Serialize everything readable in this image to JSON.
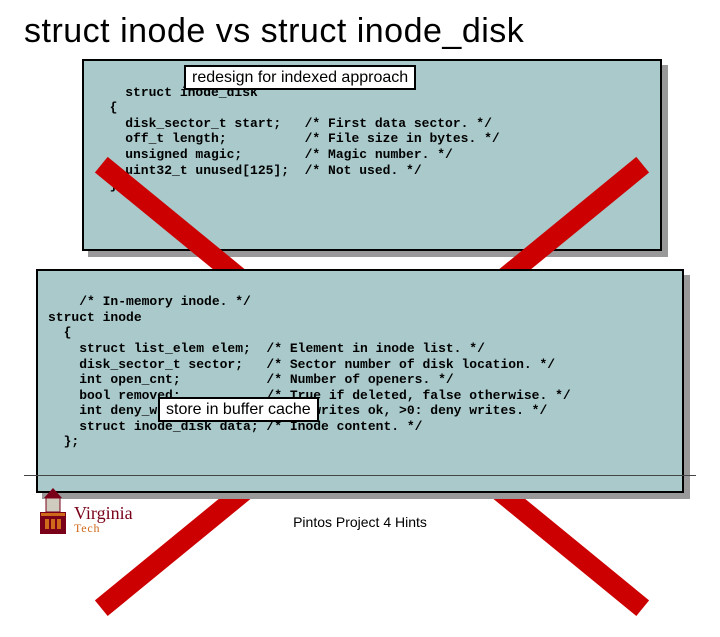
{
  "title": "struct inode vs struct inode_disk",
  "box1": {
    "code": "struct inode_disk\n  {\n    disk_sector_t start;   /* First data sector. */\n    off_t length;          /* File size in bytes. */\n    unsigned magic;        /* Magic number. */\n    uint32_t unused[125];  /* Not used. */\n  };",
    "callout": "redesign for indexed approach"
  },
  "box2": {
    "code": "/* In-memory inode. */\nstruct inode\n  {\n    struct list_elem elem;  /* Element in inode list. */\n    disk_sector_t sector;   /* Sector number of disk location. */\n    int open_cnt;           /* Number of openers. */\n    bool removed;           /* True if deleted, false otherwise. */\n    int deny_write_cnt;     /* 0: writes ok, >0: deny writes. */\n    struct inode_disk data; /* Inode content. */\n  };",
    "callout": "store in buffer cache"
  },
  "footer": "Pintos Project 4 Hints",
  "logo": {
    "line1": "Virginia",
    "line2": "Tech"
  }
}
